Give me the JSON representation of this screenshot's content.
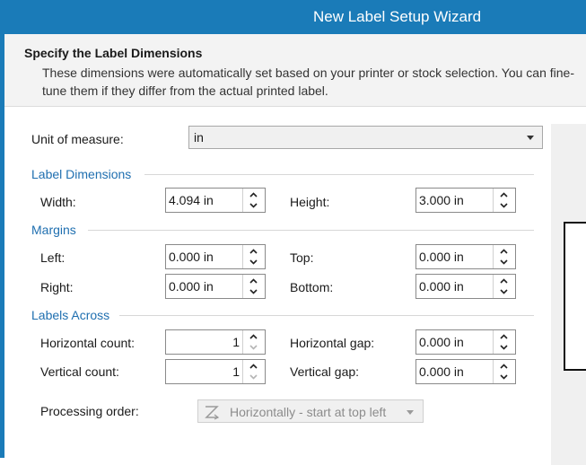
{
  "window": {
    "title": "New Label Setup Wizard"
  },
  "header": {
    "title": "Specify the Label Dimensions",
    "description": "These dimensions were automatically set based on your printer or stock selection. You can fine-tune them if they differ from the actual printed label."
  },
  "unit": {
    "label": "Unit of measure:",
    "value": "in"
  },
  "label_dimensions": {
    "section": "Label Dimensions",
    "width": {
      "label": "Width:",
      "value": "4.094 in"
    },
    "height": {
      "label": "Height:",
      "value": "3.000 in"
    }
  },
  "margins": {
    "section": "Margins",
    "left": {
      "label": "Left:",
      "value": "0.000 in"
    },
    "top": {
      "label": "Top:",
      "value": "0.000 in"
    },
    "right": {
      "label": "Right:",
      "value": "0.000 in"
    },
    "bottom": {
      "label": "Bottom:",
      "value": "0.000 in"
    }
  },
  "labels_across": {
    "section": "Labels Across",
    "horizontal_count": {
      "label": "Horizontal count:",
      "value": "1"
    },
    "horizontal_gap": {
      "label": "Horizontal gap:",
      "value": "0.000 in"
    },
    "vertical_count": {
      "label": "Vertical count:",
      "value": "1"
    },
    "vertical_gap": {
      "label": "Vertical gap:",
      "value": "0.000 in"
    }
  },
  "processing": {
    "label": "Processing order:",
    "value": "Horizontally - start at top left",
    "icon": "z-order-icon",
    "enabled": false
  },
  "colors": {
    "title_bar": "#1a7bb8",
    "section_heading": "#1f6fb0"
  }
}
